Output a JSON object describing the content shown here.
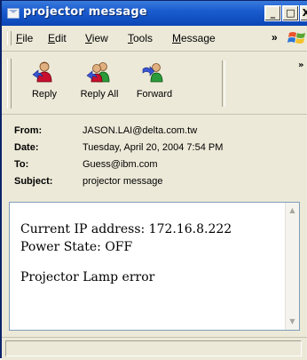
{
  "window": {
    "title": "projector message"
  },
  "titlebar_buttons": {
    "minimize": "_",
    "maximize": "□",
    "close": "X"
  },
  "menu": {
    "items": [
      {
        "label": "File",
        "accel": "F",
        "rest": "ile"
      },
      {
        "label": "Edit",
        "accel": "E",
        "rest": "dit"
      },
      {
        "label": "View",
        "accel": "V",
        "rest": "iew"
      },
      {
        "label": "Tools",
        "accel": "T",
        "rest": "ools"
      },
      {
        "label": "Message",
        "accel": "M",
        "rest": "essage"
      }
    ],
    "overflow": "»"
  },
  "toolbar": {
    "buttons": [
      {
        "label": "Reply",
        "icon": "reply-icon"
      },
      {
        "label": "Reply All",
        "icon": "reply-all-icon"
      },
      {
        "label": "Forward",
        "icon": "forward-icon"
      }
    ],
    "overflow": "»"
  },
  "header": {
    "from": {
      "label": "From:",
      "value": "JASON.LAI@delta.com.tw"
    },
    "date": {
      "label": "Date:",
      "value": "Tuesday, April 20, 2004 7:54 PM"
    },
    "to": {
      "label": "To:",
      "value": "Guess@ibm.com"
    },
    "subject": {
      "label": "Subject:",
      "value": "projector message"
    }
  },
  "body": {
    "lines": [
      "Current IP address: 172.16.8.222",
      "Power State: OFF",
      "Projector Lamp error"
    ]
  },
  "colors": {
    "titlebar": "#1a5ccf",
    "chrome": "#ece9d8"
  }
}
